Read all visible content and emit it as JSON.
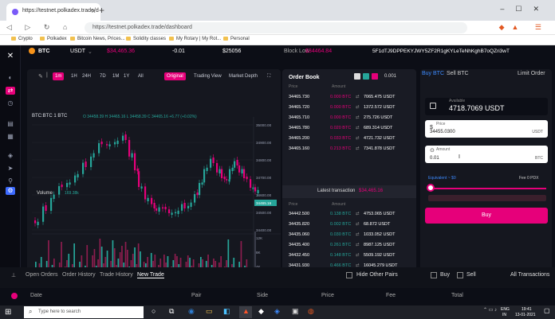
{
  "browser": {
    "tab_title": "https://testnet.polkadex.trade/d",
    "url": "https://testnet.polkadex.trade/dashboard",
    "bookmarks": [
      "Crypto",
      "Polkadex",
      "Bitcoin News, Prices...",
      "Solidity classes",
      "My Rotary | My Rot...",
      "Personal"
    ]
  },
  "topbar": {
    "asset": "BTC",
    "quote": "USDT",
    "last_price": "$34,465.36",
    "change": "-0.01",
    "volume": "$25056",
    "block_low_label": "Block Low",
    "block_low": "$34464.84",
    "address": "5F1dTJ9DPPEKYJWY5ZF2R1gKYLeTeNhKghB7oQZri3wT"
  },
  "chart": {
    "timeframes": [
      "1m",
      "1H",
      "24H",
      "7D",
      "1M",
      "1Y",
      "All"
    ],
    "active_timeframe": "1m",
    "views": [
      "Original",
      "Trading View",
      "Market Depth"
    ],
    "active_view": "Original",
    "pair_label": "BTC:BTC  1  BTC",
    "ohlc": "O 34458.39  H 34465.16  L 34458.39  C 34465.16  +6.77 (+0.02%)",
    "volume_label": "Volume",
    "volume_value": "169.38k",
    "price_ticks": [
      "35000.00",
      "34900.00",
      "34800.00",
      "34700.00",
      "34600.00",
      "34500.00",
      "34400.00"
    ],
    "current_price_tag": "34465.16",
    "volume_ticks": [
      "12K",
      "8K",
      "4K"
    ],
    "time_ticks": [
      "10:02",
      "11:02",
      "12:02",
      "13:02",
      "14:02"
    ],
    "up_color": "#26a69a",
    "down_color": "#e6007a"
  },
  "orderbook": {
    "title": "Order Book",
    "decimals": "0.001",
    "col_price": "Price",
    "col_amount": "Amount",
    "asks": [
      {
        "price": "34465.730",
        "amount": "0.000 BTC",
        "total": "7065.475 USDT"
      },
      {
        "price": "34465.720",
        "amount": "0.000 BTC",
        "total": "1372.572 USDT"
      },
      {
        "price": "34465.710",
        "amount": "0.000 BTC",
        "total": "275.726 USDT"
      },
      {
        "price": "34465.780",
        "amount": "0.020 BTC",
        "total": "689.314 USDT"
      },
      {
        "price": "34465.200",
        "amount": "0.033 BTC",
        "total": "4721.732 USDT"
      },
      {
        "price": "34465.160",
        "amount": "0.213 BTC",
        "total": "7341.878 USDT"
      }
    ],
    "latest_label": "Latest transaction",
    "latest_value": "$34,465.16",
    "bids": [
      {
        "price": "34442.500",
        "amount": "0.138 BTC",
        "total": "4753.065 USDT"
      },
      {
        "price": "34435.820",
        "amount": "0.002 BTC",
        "total": "68.872 USDT"
      },
      {
        "price": "34435.060",
        "amount": "0.030 BTC",
        "total": "1033.052 USDT"
      },
      {
        "price": "34435.400",
        "amount": "0.261 BTC",
        "total": "8987.125 USDT"
      },
      {
        "price": "34432.450",
        "amount": "0.148 BTC",
        "total": "5509.192 USDT"
      },
      {
        "price": "34431.930",
        "amount": "0.466 BTC",
        "total": "16045.279 USDT"
      }
    ]
  },
  "trade_form": {
    "tab_buy": "Buy BTC",
    "tab_sell": "Sell BTC",
    "order_type": "Limit Order",
    "available_label": "Available",
    "available_value": "4718.7069 USDT",
    "price_label": "Price",
    "price_value": "34455.0300",
    "price_unit": "USDT",
    "amount_label": "Amount",
    "amount_value": "0.01",
    "amount_unit": "BTC",
    "equivalent": "Equivalent ~ $0",
    "fee": "Fee 0 PDX",
    "buy_button": "Buy"
  },
  "bottom": {
    "tabs": [
      "Open Orders",
      "Order History",
      "Trade History",
      "New Trade"
    ],
    "active_tab": "New Trade",
    "hide_other_pairs": "Hide Other Pairs",
    "buy_label": "Buy",
    "sell_label": "Sell",
    "all_transactions": "All Transactions",
    "columns": [
      "Date",
      "Pair",
      "Side",
      "Price",
      "Fee",
      "Total"
    ]
  },
  "taskbar": {
    "search_placeholder": "Type here to search",
    "lang": "ENG",
    "region": "IN",
    "time": "19:41",
    "date": "13-01-2021"
  }
}
